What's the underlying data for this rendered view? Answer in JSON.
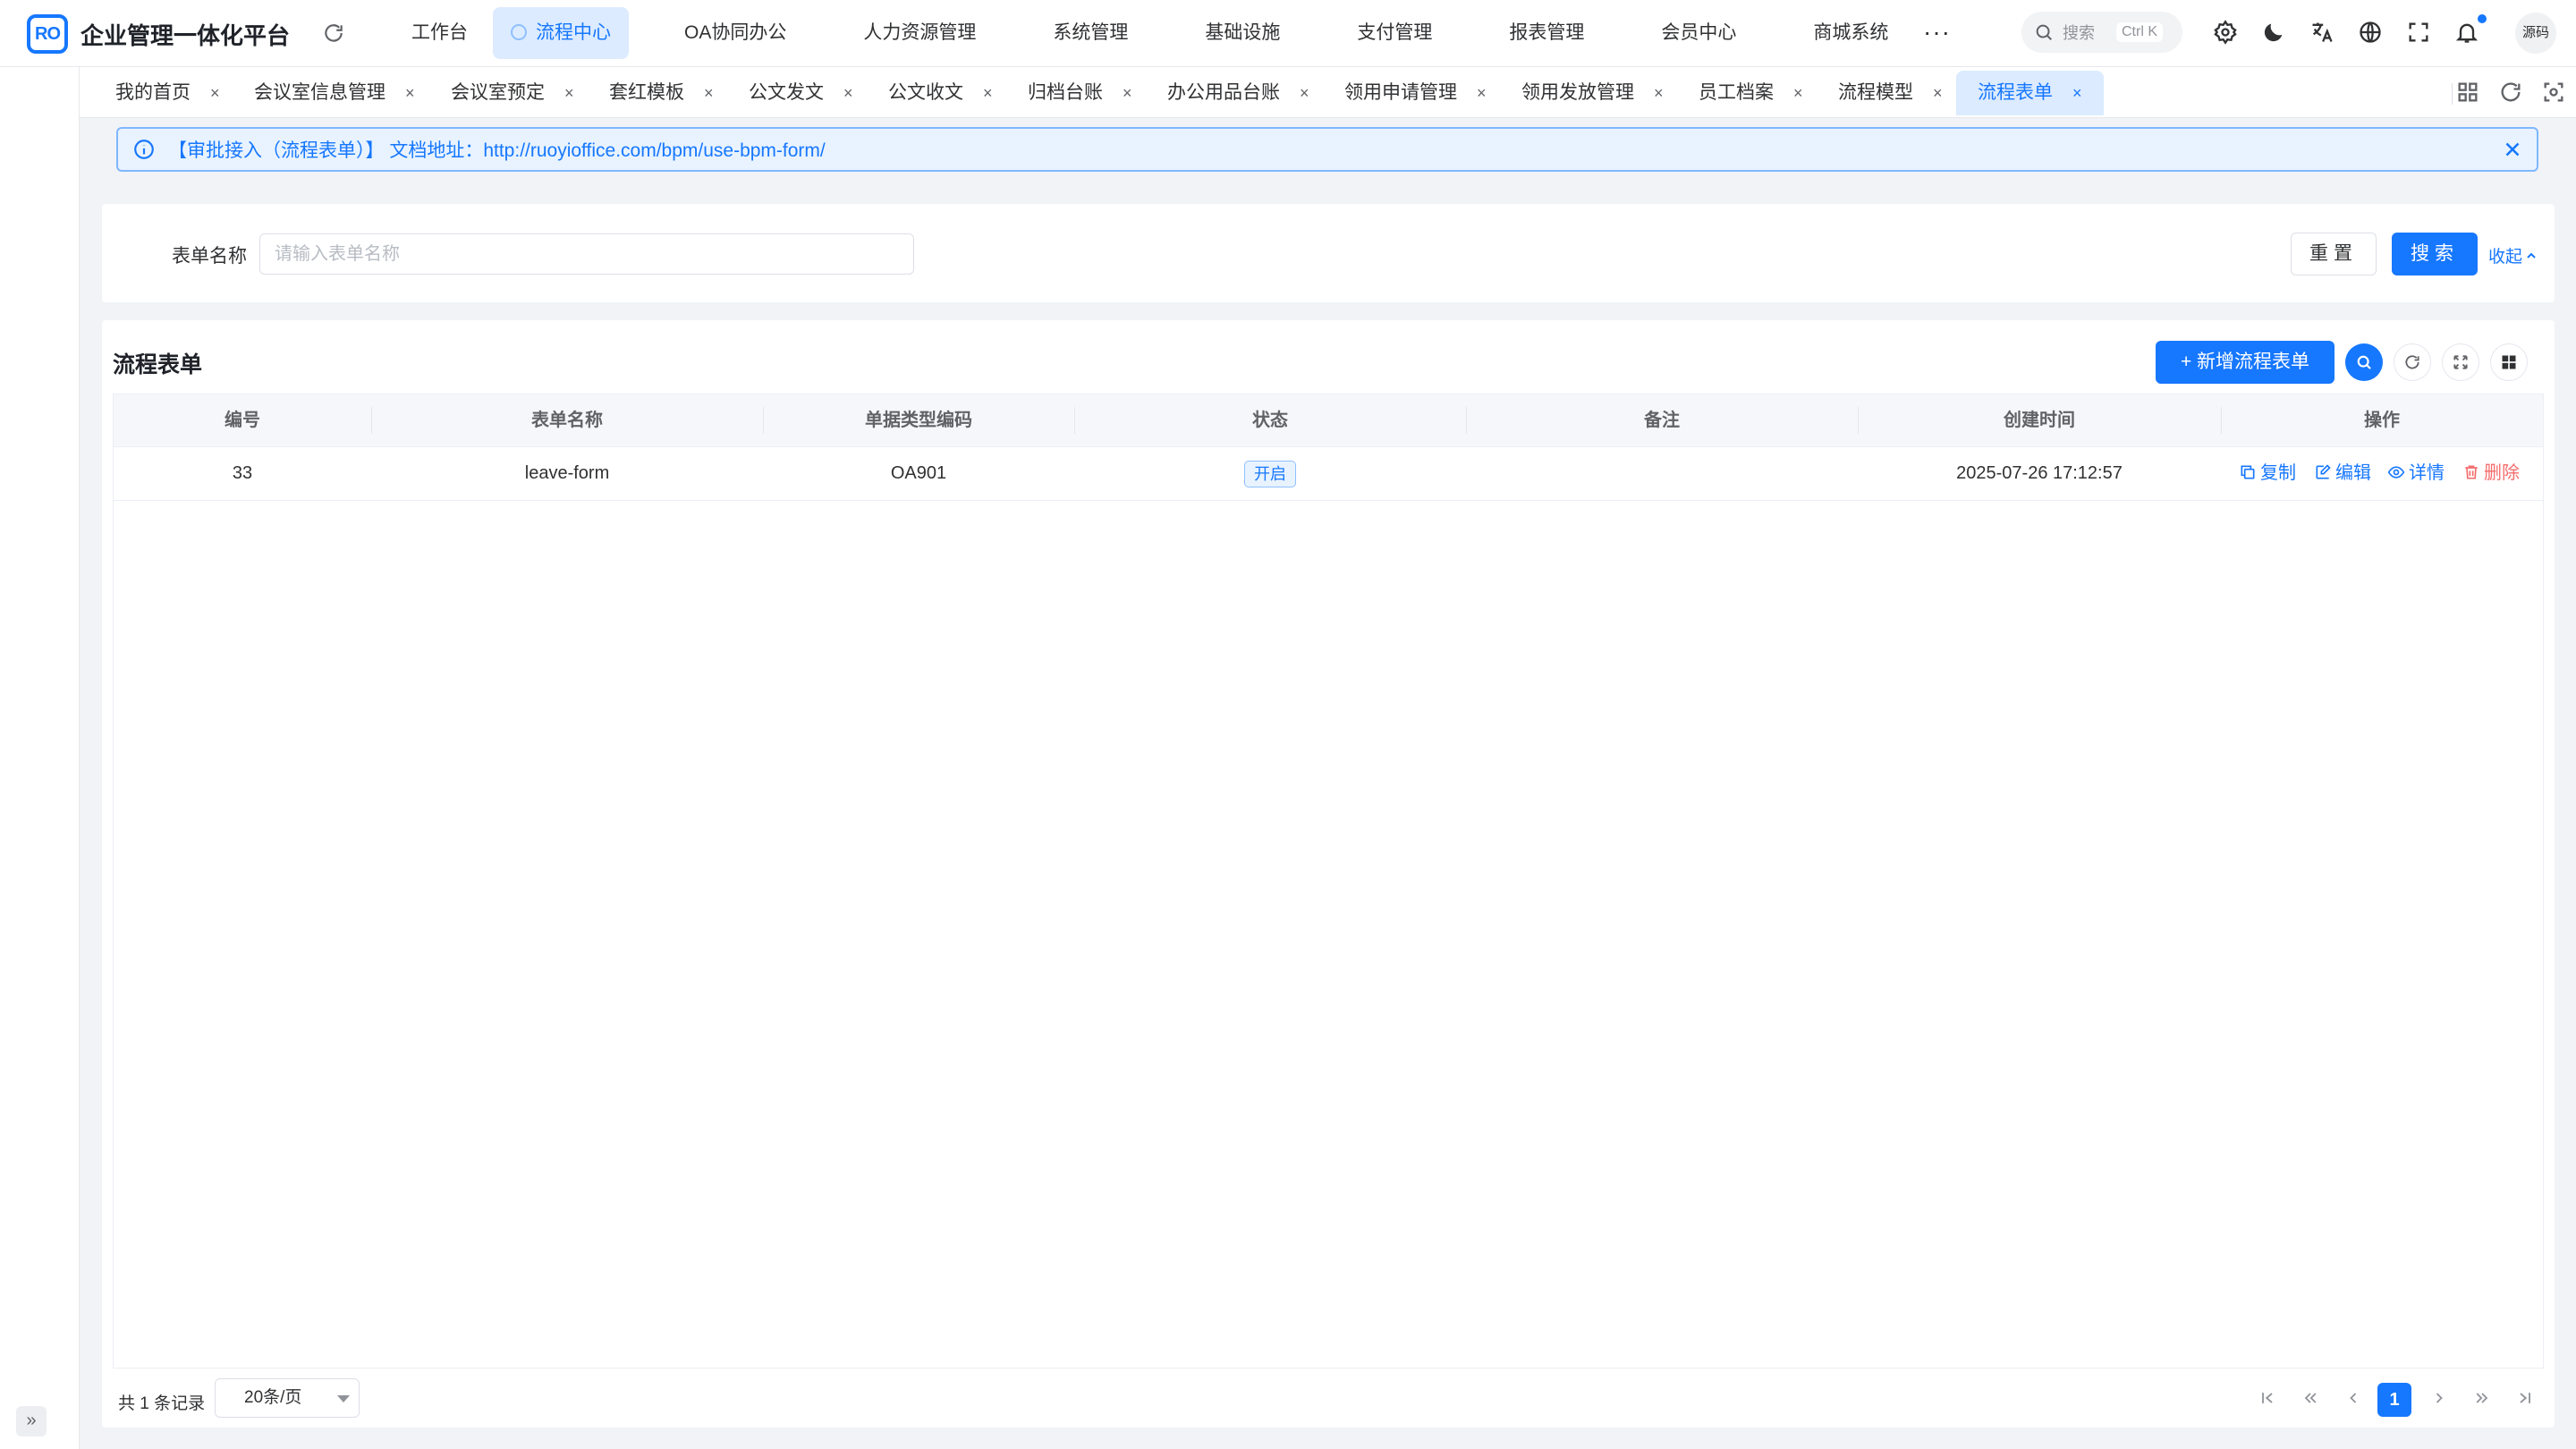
{
  "header": {
    "logo_text": "RO",
    "app_title": "企业管理一体化平台",
    "nav": [
      {
        "label": "工作台"
      },
      {
        "label": "流程中心",
        "active": true
      },
      {
        "label": "OA协同办公"
      },
      {
        "label": "人力资源管理"
      },
      {
        "label": "系统管理"
      },
      {
        "label": "基础设施"
      },
      {
        "label": "支付管理"
      },
      {
        "label": "报表管理"
      },
      {
        "label": "会员中心"
      },
      {
        "label": "商城系统"
      }
    ],
    "more": "···",
    "search_placeholder": "搜索",
    "search_shortcut": "Ctrl K",
    "avatar_text": "源码"
  },
  "tabs": [
    {
      "label": "我的首页"
    },
    {
      "label": "会议室信息管理"
    },
    {
      "label": "会议室预定"
    },
    {
      "label": "套红模板"
    },
    {
      "label": "公文发文"
    },
    {
      "label": "公文收文"
    },
    {
      "label": "归档台账"
    },
    {
      "label": "办公用品台账"
    },
    {
      "label": "领用申请管理"
    },
    {
      "label": "领用发放管理"
    },
    {
      "label": "员工档案"
    },
    {
      "label": "流程模型"
    },
    {
      "label": "流程表单",
      "active": true
    }
  ],
  "tab_close": "×",
  "alert": {
    "text": "【审批接入（流程表单）】 文档地址：http://ruoyioffice.com/bpm/use-bpm-form/"
  },
  "search_form": {
    "label": "表单名称",
    "placeholder": "请输入表单名称",
    "value": "",
    "reset_label": "重置",
    "search_label": "搜索",
    "collapse_label": "收起"
  },
  "table": {
    "title": "流程表单",
    "add_label": "+ 新增流程表单",
    "columns": [
      "编号",
      "表单名称",
      "单据类型编码",
      "状态",
      "备注",
      "创建时间",
      "操作"
    ],
    "rows": [
      {
        "id": "33",
        "name": "leave-form",
        "code": "OA901",
        "status": "开启",
        "remark": "",
        "created": "2025-07-26 17:12:57",
        "actions": [
          "复制",
          "编辑",
          "详情",
          "删除"
        ]
      }
    ]
  },
  "pagination": {
    "total_text": "共 1 条记录",
    "page_size": "20条/页",
    "current_page": "1"
  },
  "colors": {
    "primary": "#1677ff",
    "danger": "#f56c6c",
    "tab_active_bg": "#dcebff"
  }
}
